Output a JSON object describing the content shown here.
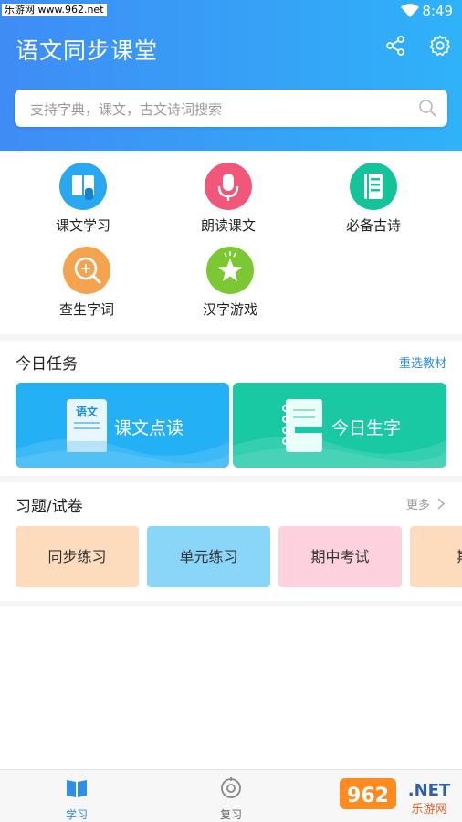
{
  "status_bar": {
    "watermark": "乐游网 www.962.net",
    "time": "8:49"
  },
  "header": {
    "title": "语文同步课堂"
  },
  "search": {
    "placeholder": "支持字典，课文，古文诗词搜索"
  },
  "features": [
    {
      "label": "课文学习",
      "icon": "book-hand-icon",
      "color": "#2aa8ef"
    },
    {
      "label": "朗读课文",
      "icon": "microphone-icon",
      "color": "#f0577a"
    },
    {
      "label": "必备古诗",
      "icon": "classic-book-icon",
      "color": "#14c39a"
    },
    {
      "label": "查生字词",
      "icon": "magnifier-character-icon",
      "color": "#f4a44f"
    },
    {
      "label": "汉字游戏",
      "icon": "star-game-icon",
      "color": "#7bc832"
    }
  ],
  "tasks": {
    "title": "今日任务",
    "link": "重选教材",
    "buttons": [
      {
        "label": "课文点读",
        "book_text": "语文",
        "color": "#23b0f5"
      },
      {
        "label": "今日生字",
        "color": "#19c9a4"
      }
    ]
  },
  "exercises": {
    "title": "习题/试卷",
    "more": "更多",
    "items": [
      {
        "label": "同步练习",
        "color": "#fddcbd"
      },
      {
        "label": "单元练习",
        "color": "#8ad6f8"
      },
      {
        "label": "期中考试",
        "color": "#fdd1de"
      },
      {
        "label": "期末",
        "color": "#fddcbd"
      }
    ]
  },
  "tabbar": {
    "tabs": [
      {
        "label": "学习",
        "active": true,
        "color": "#2f8ee8"
      },
      {
        "label": "复习",
        "active": false,
        "color": "#666666"
      }
    ],
    "brand_watermark": "962.NET 乐游网"
  }
}
